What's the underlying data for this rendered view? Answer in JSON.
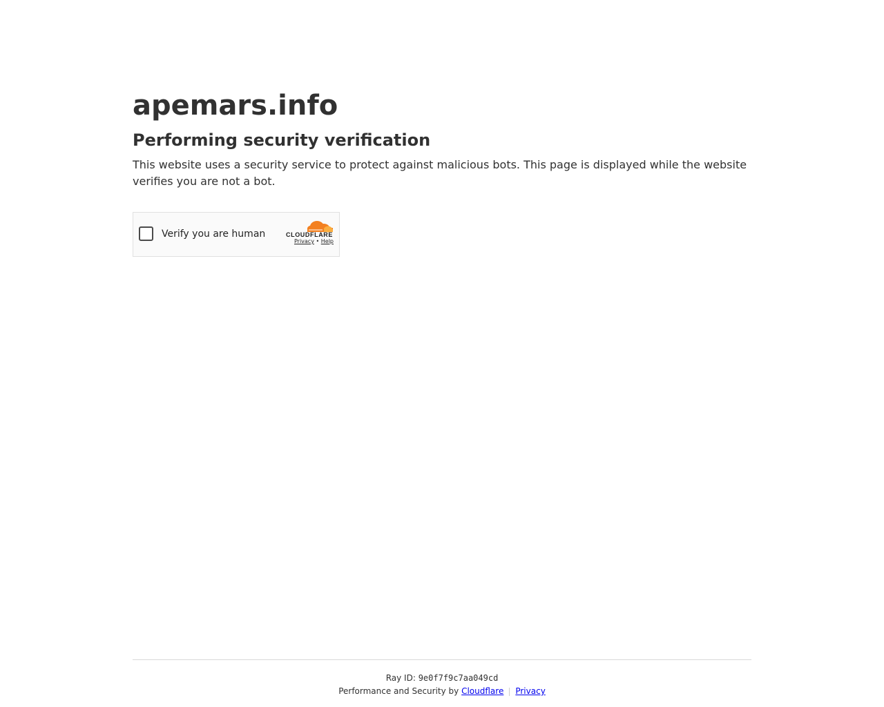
{
  "site": {
    "domain": "apemars.info",
    "heading": "Performing security verification",
    "description": "This website uses a security service to protect against malicious bots. This page is displayed while the website verifies you are not a bot."
  },
  "widget": {
    "checkbox_label": "Verify you are human",
    "checked": false,
    "brand_name": "CLOUDFLARE",
    "privacy_link": "Privacy",
    "links_separator": "•",
    "help_link": "Help",
    "brand_color": "#f38020"
  },
  "footer": {
    "ray_label": "Ray ID:",
    "ray_id": "9e0f7f9c7aa049cd",
    "performance_text": "Performance and Security by",
    "cloudflare_link": "Cloudflare",
    "privacy_link": "Privacy"
  }
}
